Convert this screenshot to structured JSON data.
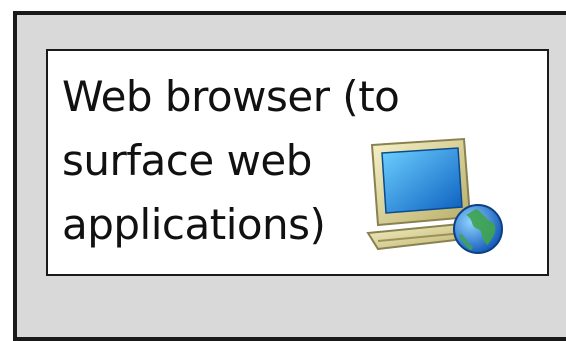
{
  "node": {
    "label_lines": [
      "Web browser (to",
      "surface web",
      "applications)"
    ],
    "icon": "computer-globe-icon"
  },
  "colors": {
    "outer_fill": "#d9d9d9",
    "inner_fill": "#ffffff",
    "border": "#1a1a1a",
    "screen": "#1e8ee0",
    "monitor_body": "#e9e3a8",
    "globe": "#2b7fd6",
    "globe_land": "#3fa34d"
  }
}
